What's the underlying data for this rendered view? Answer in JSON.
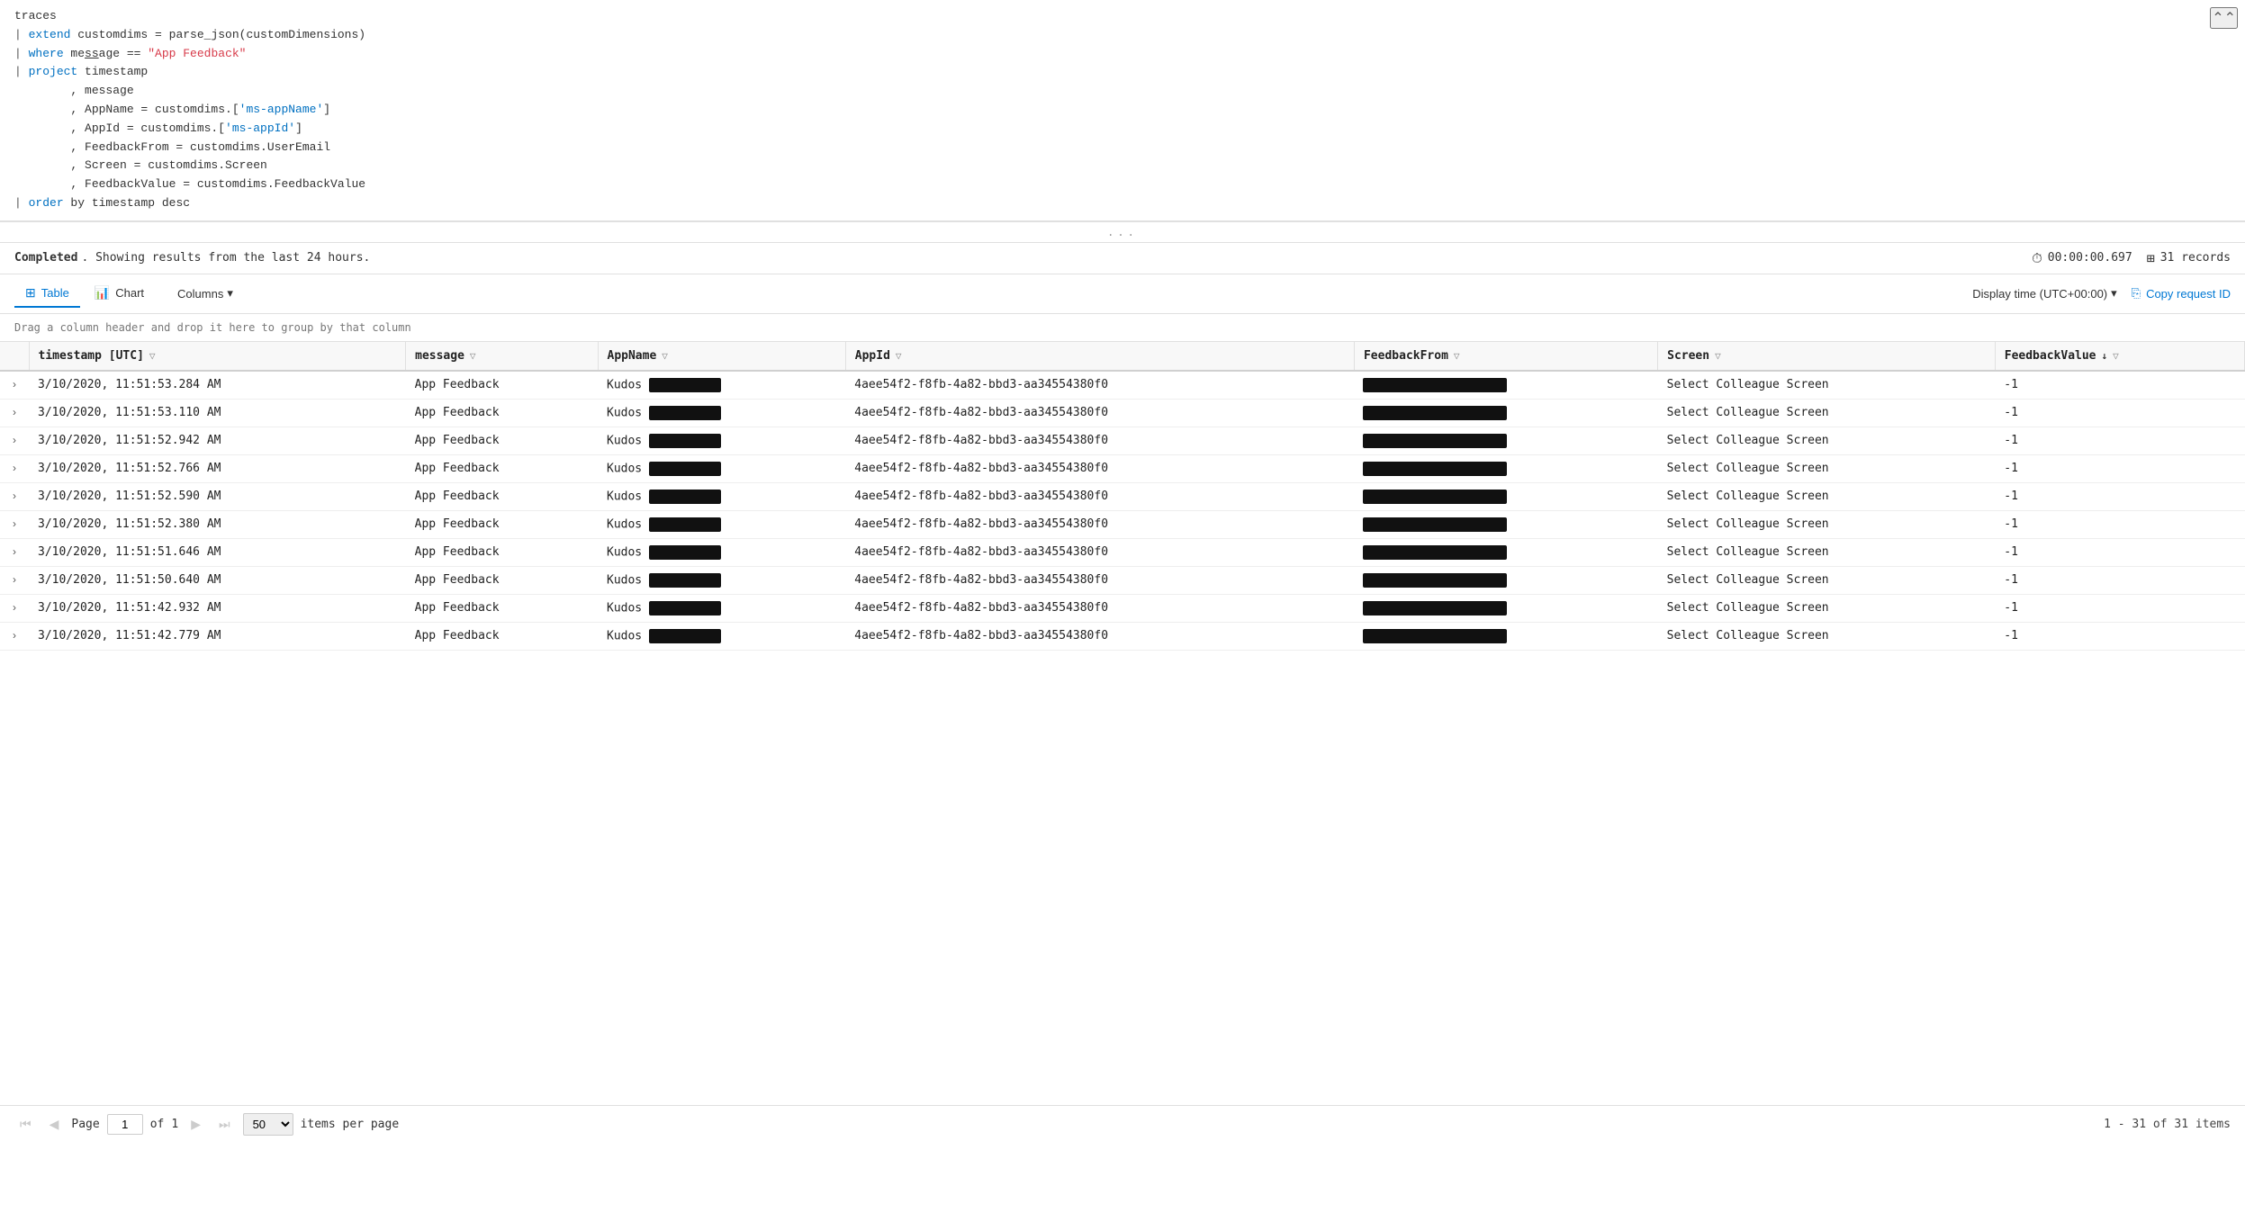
{
  "editor": {
    "lines": [
      {
        "id": 1,
        "indent": "",
        "prefix": "",
        "parts": [
          {
            "text": "traces",
            "color": "normal"
          }
        ]
      },
      {
        "id": 2,
        "indent": "| ",
        "prefix": "",
        "parts": [
          {
            "text": "extend ",
            "color": "blue"
          },
          {
            "text": "customdims = parse_json(customDimensions)",
            "color": "normal"
          }
        ]
      },
      {
        "id": 3,
        "indent": "| ",
        "prefix": "",
        "parts": [
          {
            "text": "where ",
            "color": "blue"
          },
          {
            "text": "message == ",
            "color": "normal"
          },
          {
            "text": "\"App Feedback\"",
            "color": "red"
          }
        ]
      },
      {
        "id": 4,
        "indent": "| ",
        "prefix": "",
        "parts": [
          {
            "text": "project ",
            "color": "blue"
          },
          {
            "text": "timestamp",
            "color": "normal"
          }
        ]
      },
      {
        "id": 5,
        "indent": "        ",
        "prefix": ", ",
        "parts": [
          {
            "text": "message",
            "color": "normal"
          }
        ]
      },
      {
        "id": 6,
        "indent": "        ",
        "prefix": ", ",
        "parts": [
          {
            "text": "AppName = customdims.[",
            "color": "normal"
          },
          {
            "text": "'ms-appName'",
            "color": "blue"
          },
          {
            "text": "]",
            "color": "normal"
          }
        ]
      },
      {
        "id": 7,
        "indent": "        ",
        "prefix": ", ",
        "parts": [
          {
            "text": "AppId = customdims.[",
            "color": "normal"
          },
          {
            "text": "'ms-appId'",
            "color": "blue"
          },
          {
            "text": "]",
            "color": "normal"
          }
        ]
      },
      {
        "id": 8,
        "indent": "        ",
        "prefix": ", ",
        "parts": [
          {
            "text": "FeedbackFrom = customdims.UserEmail",
            "color": "normal"
          }
        ]
      },
      {
        "id": 9,
        "indent": "        ",
        "prefix": ", ",
        "parts": [
          {
            "text": "Screen = customdims.Screen",
            "color": "normal"
          }
        ]
      },
      {
        "id": 10,
        "indent": "        ",
        "prefix": ", ",
        "parts": [
          {
            "text": "FeedbackValue = customdims.FeedbackValue",
            "color": "normal"
          }
        ]
      },
      {
        "id": 11,
        "indent": "| ",
        "prefix": "",
        "parts": [
          {
            "text": "order ",
            "color": "blue"
          },
          {
            "text": "by timestamp desc",
            "color": "normal"
          }
        ]
      }
    ]
  },
  "drag_handle": "...",
  "status": {
    "completed_text": "Completed",
    "message": ". Showing results from the last 24 hours.",
    "time_label": "00:00:00.697",
    "records_label": "31 records"
  },
  "toolbar": {
    "tab_table_label": "Table",
    "tab_chart_label": "Chart",
    "columns_label": "Columns",
    "display_time_label": "Display time (UTC+00:00)",
    "copy_request_label": "Copy request ID"
  },
  "drag_hint_text": "Drag a column header and drop it here to group by that column",
  "table": {
    "columns": [
      {
        "id": "expand",
        "label": ""
      },
      {
        "id": "timestamp",
        "label": "timestamp [UTC]",
        "filter": true,
        "sort": false
      },
      {
        "id": "message",
        "label": "message",
        "filter": true,
        "sort": false
      },
      {
        "id": "AppName",
        "label": "AppName",
        "filter": true,
        "sort": false
      },
      {
        "id": "AppId",
        "label": "AppId",
        "filter": true,
        "sort": false
      },
      {
        "id": "FeedbackFrom",
        "label": "FeedbackFrom",
        "filter": true,
        "sort": false
      },
      {
        "id": "Screen",
        "label": "Screen",
        "filter": true,
        "sort": false
      },
      {
        "id": "FeedbackValue",
        "label": "FeedbackValue",
        "filter": true,
        "sort": true
      }
    ],
    "rows": [
      {
        "timestamp": "3/10/2020, 11:51:53.284 AM",
        "message": "App Feedback",
        "appName": "Kudos",
        "appId": "4aee54f2-f8fb-4a82-bbd3-aa34554380f0",
        "screen": "Select Colleague Screen",
        "feedbackValue": "-1"
      },
      {
        "timestamp": "3/10/2020, 11:51:53.110 AM",
        "message": "App Feedback",
        "appName": "Kudos",
        "appId": "4aee54f2-f8fb-4a82-bbd3-aa34554380f0",
        "screen": "Select Colleague Screen",
        "feedbackValue": "-1"
      },
      {
        "timestamp": "3/10/2020, 11:51:52.942 AM",
        "message": "App Feedback",
        "appName": "Kudos",
        "appId": "4aee54f2-f8fb-4a82-bbd3-aa34554380f0",
        "screen": "Select Colleague Screen",
        "feedbackValue": "-1"
      },
      {
        "timestamp": "3/10/2020, 11:51:52.766 AM",
        "message": "App Feedback",
        "appName": "Kudos",
        "appId": "4aee54f2-f8fb-4a82-bbd3-aa34554380f0",
        "screen": "Select Colleague Screen",
        "feedbackValue": "-1"
      },
      {
        "timestamp": "3/10/2020, 11:51:52.590 AM",
        "message": "App Feedback",
        "appName": "Kudos",
        "appId": "4aee54f2-f8fb-4a82-bbd3-aa34554380f0",
        "screen": "Select Colleague Screen",
        "feedbackValue": "-1"
      },
      {
        "timestamp": "3/10/2020, 11:51:52.380 AM",
        "message": "App Feedback",
        "appName": "Kudos",
        "appId": "4aee54f2-f8fb-4a82-bbd3-aa34554380f0",
        "screen": "Select Colleague Screen",
        "feedbackValue": "-1"
      },
      {
        "timestamp": "3/10/2020, 11:51:51.646 AM",
        "message": "App Feedback",
        "appName": "Kudos",
        "appId": "4aee54f2-f8fb-4a82-bbd3-aa34554380f0",
        "screen": "Select Colleague Screen",
        "feedbackValue": "-1"
      },
      {
        "timestamp": "3/10/2020, 11:51:50.640 AM",
        "message": "App Feedback",
        "appName": "Kudos",
        "appId": "4aee54f2-f8fb-4a82-bbd3-aa34554380f0",
        "screen": "Select Colleague Screen",
        "feedbackValue": "-1"
      },
      {
        "timestamp": "3/10/2020, 11:51:42.932 AM",
        "message": "App Feedback",
        "appName": "Kudos",
        "appId": "4aee54f2-f8fb-4a82-bbd3-aa34554380f0",
        "screen": "Select Colleague Screen",
        "feedbackValue": "-1"
      },
      {
        "timestamp": "3/10/2020, 11:51:42.779 AM",
        "message": "App Feedback",
        "appName": "Kudos",
        "appId": "4aee54f2-f8fb-4a82-bbd3-aa34554380f0",
        "screen": "Select Colleague Screen",
        "feedbackValue": "-1"
      }
    ]
  },
  "pagination": {
    "page_label": "Page",
    "current_page": "1",
    "of_label": "of",
    "total_pages": "1",
    "per_page_value": "50",
    "items_label": "items per page",
    "range_text": "1 - 31 of 31 items"
  }
}
